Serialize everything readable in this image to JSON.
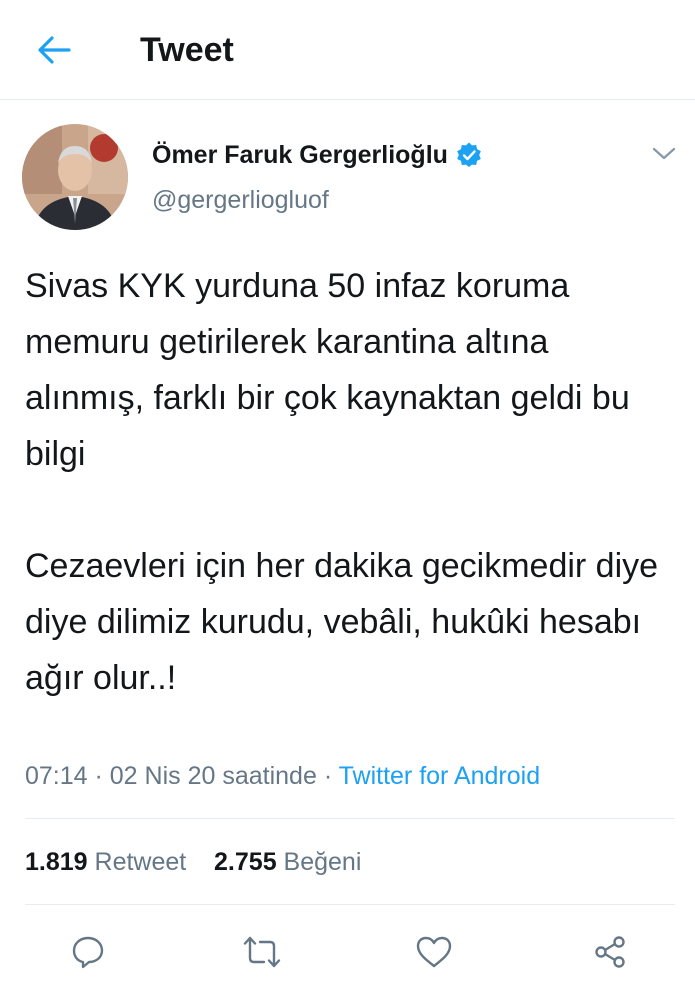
{
  "header": {
    "title": "Tweet",
    "back_icon": "arrow-left-icon"
  },
  "author": {
    "display_name": "Ömer Faruk Gergerlioğlu",
    "handle": "@gergerliogluof",
    "verified": true
  },
  "tweet": {
    "paragraphs": [
      "Sivas KYK yurduna 50 infaz koruma memuru getirilerek karantina altına alınmış, farklı bir çok kaynaktan geldi bu bilgi",
      "Cezaevleri için her dakika gecikmedir diye diye dilimiz kurudu, vebâli, hukûki hesabı ağır olur..!"
    ],
    "time": "07:14",
    "sep1": " · ",
    "date": "02 Nis 20 saatinde",
    "sep2": " · ",
    "source": "Twitter for Android"
  },
  "stats": {
    "retweets_count": "1.819",
    "retweets_label": "Retweet",
    "likes_count": "2.755",
    "likes_label": "Beğeni"
  },
  "actions": [
    "reply-icon",
    "retweet-icon",
    "like-icon",
    "share-icon"
  ],
  "colors": {
    "accent": "#1da1f2",
    "text_primary": "#14171a",
    "text_secondary": "#657786",
    "divider": "#e6ecf0",
    "icon": "#657786"
  }
}
